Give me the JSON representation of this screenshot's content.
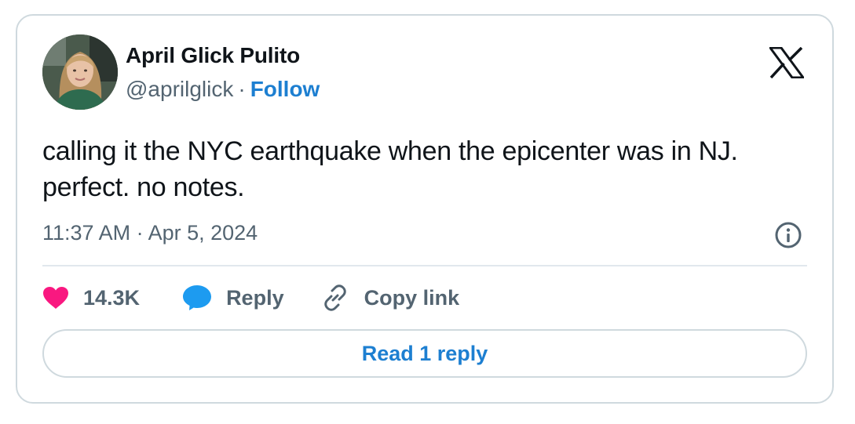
{
  "author": {
    "name": "April Glick Pulito",
    "handle": "@aprilglick",
    "separator": "·",
    "follow_label": "Follow",
    "avatar_icon": "profile-photo"
  },
  "platform_icon": "x-logo-icon",
  "tweet": {
    "text": "calling it the NYC earthquake when the epicenter was in NJ. perfect. no notes.",
    "timestamp": "11:37 AM · Apr 5, 2024"
  },
  "actions": {
    "like_count": "14.3K",
    "reply_label": "Reply",
    "copy_link_label": "Copy link"
  },
  "read_replies_label": "Read 1 reply",
  "colors": {
    "like": "#f91880",
    "reply": "#1d9bf0",
    "link": "#1d7fd1",
    "text": "#0f1419",
    "secondary": "#536471",
    "border": "#cfd9de"
  }
}
